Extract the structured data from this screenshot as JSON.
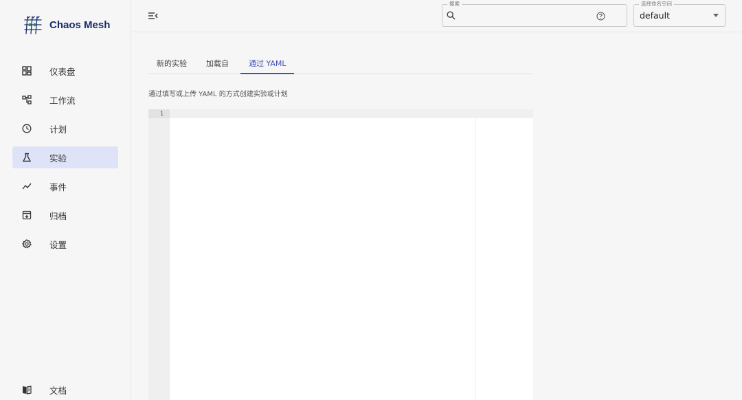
{
  "brand": {
    "name": "Chaos Mesh"
  },
  "sidebar": {
    "items": [
      {
        "label": "仪表盘",
        "icon": "dashboard-icon"
      },
      {
        "label": "工作流",
        "icon": "workflow-icon"
      },
      {
        "label": "计划",
        "icon": "schedule-clock-icon"
      },
      {
        "label": "实验",
        "icon": "flask-icon",
        "active": true
      },
      {
        "label": "事件",
        "icon": "events-chart-icon"
      },
      {
        "label": "归档",
        "icon": "archive-icon"
      },
      {
        "label": "设置",
        "icon": "settings-gear-icon"
      }
    ],
    "docs": {
      "label": "文档",
      "icon": "book-icon"
    }
  },
  "topbar": {
    "search": {
      "legend": "搜索",
      "value": ""
    },
    "namespace": {
      "legend": "选择命名空间",
      "value": "default"
    }
  },
  "main": {
    "tabs": [
      {
        "label": "新的实验"
      },
      {
        "label": "加载自"
      },
      {
        "label": "通过 YAML",
        "active": true
      }
    ],
    "hint": "通过填写或上传 YAML 的方式创建实验或计划",
    "editor": {
      "line_numbers": [
        "1"
      ]
    }
  },
  "colors": {
    "accent": "#3f51b5",
    "active_nav_bg": "#dfe3f8",
    "brand_text": "#172b6b",
    "background": "#f6f6f6"
  }
}
